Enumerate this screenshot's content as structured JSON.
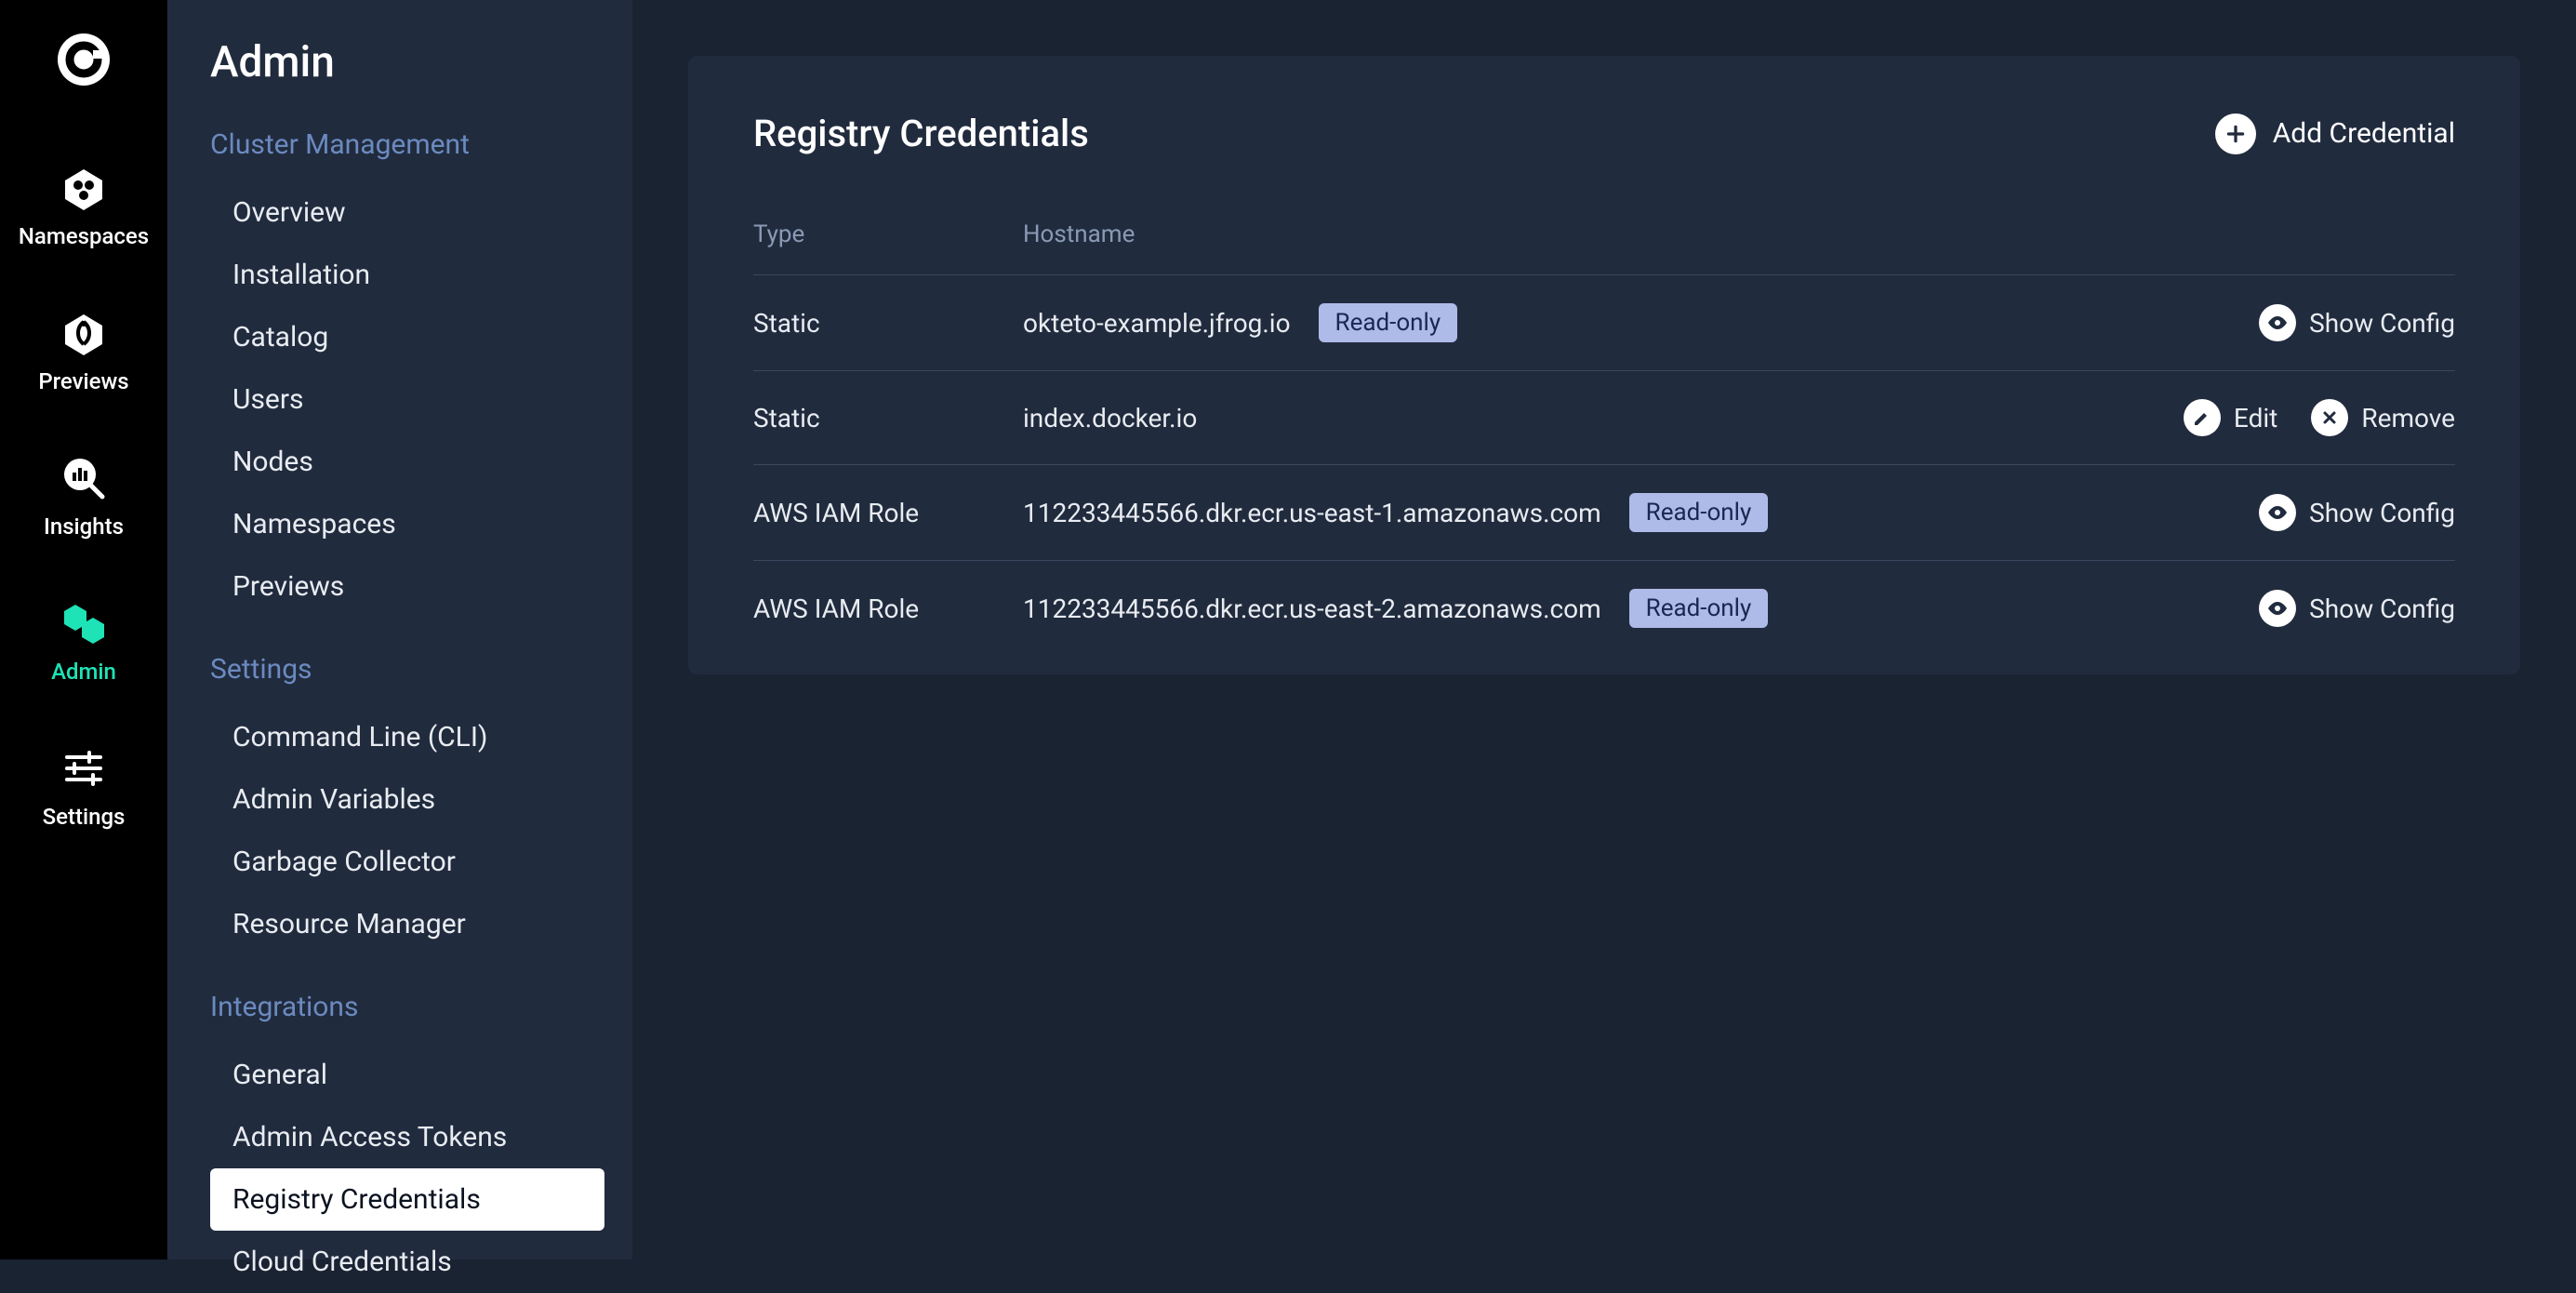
{
  "rail": {
    "items": [
      {
        "id": "namespaces",
        "label": "Namespaces",
        "active": false
      },
      {
        "id": "previews",
        "label": "Previews",
        "active": false
      },
      {
        "id": "insights",
        "label": "Insights",
        "active": false
      },
      {
        "id": "admin",
        "label": "Admin",
        "active": true
      },
      {
        "id": "settings",
        "label": "Settings",
        "active": false
      }
    ]
  },
  "sidebar": {
    "title": "Admin",
    "sections": [
      {
        "header": "Cluster Management",
        "items": [
          {
            "label": "Overview"
          },
          {
            "label": "Installation"
          },
          {
            "label": "Catalog"
          },
          {
            "label": "Users"
          },
          {
            "label": "Nodes"
          },
          {
            "label": "Namespaces"
          },
          {
            "label": "Previews"
          }
        ]
      },
      {
        "header": "Settings",
        "items": [
          {
            "label": "Command Line (CLI)"
          },
          {
            "label": "Admin Variables"
          },
          {
            "label": "Garbage Collector"
          },
          {
            "label": "Resource Manager"
          }
        ]
      },
      {
        "header": "Integrations",
        "items": [
          {
            "label": "General"
          },
          {
            "label": "Admin Access Tokens"
          },
          {
            "label": "Registry Credentials",
            "active": true
          },
          {
            "label": "Cloud Credentials"
          }
        ]
      }
    ]
  },
  "page": {
    "title": "Registry Credentials",
    "add_label": "Add Credential",
    "columns": {
      "type": "Type",
      "hostname": "Hostname"
    },
    "badge_readonly": "Read-only",
    "actions": {
      "show_config": "Show Config",
      "edit": "Edit",
      "remove": "Remove"
    },
    "rows": [
      {
        "type": "Static",
        "hostname": "okteto-example.jfrog.io",
        "readonly": true,
        "actions": [
          "show_config"
        ]
      },
      {
        "type": "Static",
        "hostname": "index.docker.io",
        "readonly": false,
        "actions": [
          "edit",
          "remove"
        ]
      },
      {
        "type": "AWS IAM Role",
        "hostname": "112233445566.dkr.ecr.us-east-1.amazonaws.com",
        "readonly": true,
        "actions": [
          "show_config"
        ]
      },
      {
        "type": "AWS IAM Role",
        "hostname": "112233445566.dkr.ecr.us-east-2.amazonaws.com",
        "readonly": true,
        "actions": [
          "show_config"
        ]
      }
    ]
  }
}
